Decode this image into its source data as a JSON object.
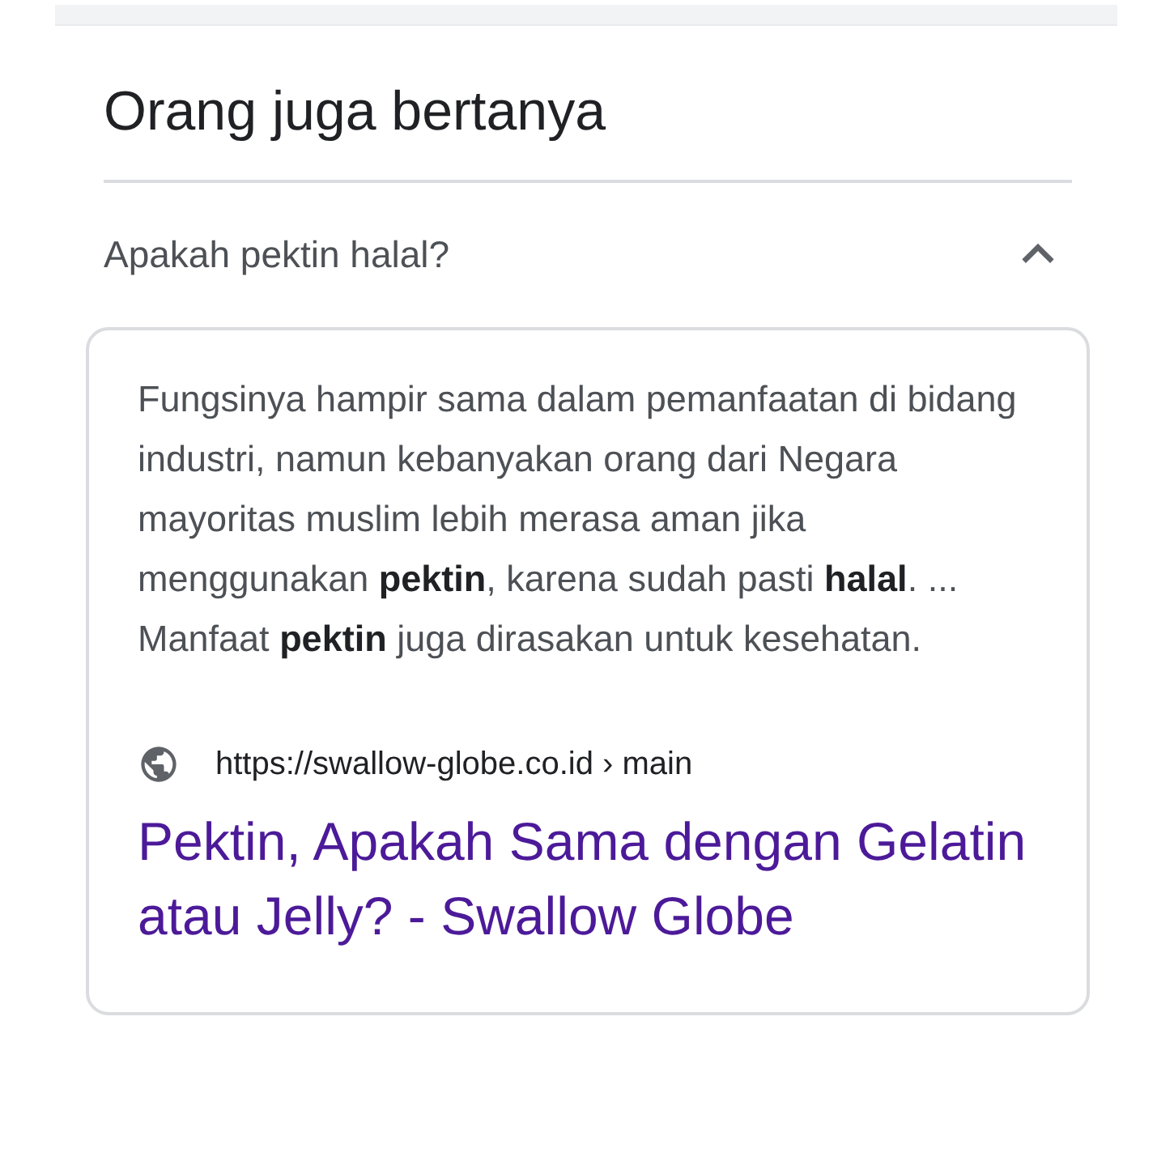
{
  "heading": "Orang juga bertanya",
  "questions": [
    {
      "question": "Apakah pektin halal?",
      "expanded": true,
      "answer": "Fungsinya hampir sama dalam pemanfaatan di bidang industri, namun kebanyakan orang dari Negara mayoritas muslim lebih merasa aman jika menggunakan **pektin**, karena sudah pasti **halal**. ... Manfaat **pektin** juga dirasakan untuk kesehatan.",
      "source_url": "https://swallow-globe.co.id › main",
      "result_title": "Pektin, Apakah Sama dengan Gelatin atau Jelly? - Swallow Globe"
    }
  ]
}
